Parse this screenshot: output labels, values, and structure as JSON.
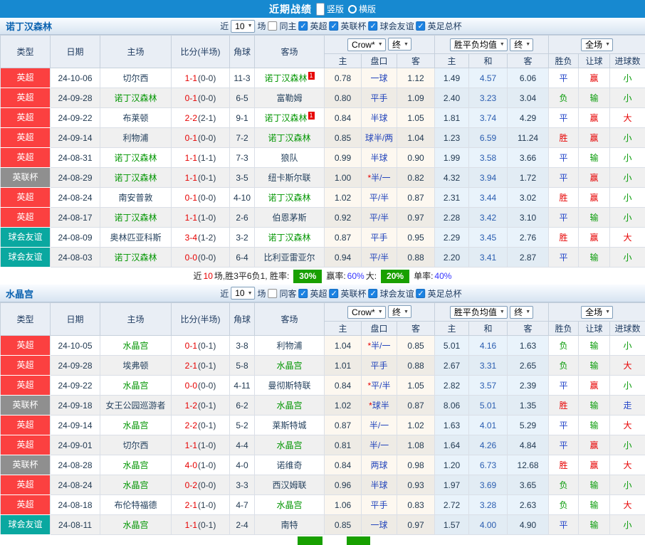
{
  "topbar": {
    "title": "近期战绩",
    "vertical": "竖版",
    "horizontal": "横版"
  },
  "filters": {
    "near": "近",
    "count": "10",
    "unit": "场",
    "leagues": [
      "英超",
      "英联杯",
      "球会友谊",
      "英足总杯"
    ]
  },
  "grid": {
    "col_type": "类型",
    "col_date": "日期",
    "col_home": "主场",
    "col_score": "比分(半场)",
    "col_corner": "角球",
    "col_away": "客场",
    "sel_crow": "Crow*",
    "sel_final": "终",
    "sel_avg": "胜平负均值",
    "sel_scope": "全场",
    "sub_home": "主",
    "sub_handicap": "盘口",
    "sub_away": "客",
    "sub_home2": "主",
    "sub_draw": "和",
    "sub_away2": "客",
    "col_wdl": "胜负",
    "col_let": "让球",
    "col_goals": "进球数"
  },
  "row_fields": [
    "league",
    "date",
    "home",
    "home_sup",
    "score_ft",
    "score_ht",
    "corner",
    "away",
    "away_sup",
    "crow_home",
    "handicap",
    "crow_away",
    "avg_home",
    "avg_draw",
    "avg_away",
    "wdl",
    "let_result",
    "goal_result"
  ],
  "colors": {
    "topbar_blue": "#1789d0",
    "focus_team_green": "#009500",
    "score_red": "#e60000",
    "handicap_blue": "#2244bb",
    "summary_box_green": "#18a000",
    "league_badge": {
      "英超": "#fb4040",
      "英联杯": "#8f8f8f",
      "球会友谊": "#0aa8a0"
    },
    "value_colors": {
      "胜": "#e60000",
      "平": "#2143c8",
      "负": "#089b08",
      "赢": "#e60000",
      "输": "#089b08",
      "大": "#e60000",
      "小": "#089b08",
      "走": "#2143c8"
    }
  },
  "sections": [
    {
      "team": "诺丁汉森林",
      "same_label": "同主",
      "rows": [
        [
          "英超",
          "24-10-06",
          "切尔西",
          "",
          "1-1",
          "(0-0)",
          "11-3",
          "诺丁汉森林",
          "1",
          "0.78",
          "一球",
          "1.12",
          "1.49",
          "4.57",
          "6.06",
          "平",
          "赢",
          "小"
        ],
        [
          "英超",
          "24-09-28",
          "诺丁汉森林",
          "",
          "0-1",
          "(0-0)",
          "6-5",
          "富勒姆",
          "",
          "0.80",
          "平手",
          "1.09",
          "2.40",
          "3.23",
          "3.04",
          "负",
          "输",
          "小"
        ],
        [
          "英超",
          "24-09-22",
          "布莱顿",
          "",
          "2-2",
          "(2-1)",
          "9-1",
          "诺丁汉森林",
          "1",
          "0.84",
          "半球",
          "1.05",
          "1.81",
          "3.74",
          "4.29",
          "平",
          "赢",
          "大"
        ],
        [
          "英超",
          "24-09-14",
          "利物浦",
          "",
          "0-1",
          "(0-0)",
          "7-2",
          "诺丁汉森林",
          "",
          "0.85",
          "球半/两",
          "1.04",
          "1.23",
          "6.59",
          "11.24",
          "胜",
          "赢",
          "小"
        ],
        [
          "英超",
          "24-08-31",
          "诺丁汉森林",
          "",
          "1-1",
          "(1-1)",
          "7-3",
          "狼队",
          "",
          "0.99",
          "半球",
          "0.90",
          "1.99",
          "3.58",
          "3.66",
          "平",
          "输",
          "小"
        ],
        [
          "英联杯",
          "24-08-29",
          "诺丁汉森林",
          "",
          "1-1",
          "(0-1)",
          "3-5",
          "纽卡斯尔联",
          "",
          "1.00",
          "*半/一",
          "0.82",
          "4.32",
          "3.94",
          "1.72",
          "平",
          "赢",
          "小"
        ],
        [
          "英超",
          "24-08-24",
          "南安普敦",
          "",
          "0-1",
          "(0-0)",
          "4-10",
          "诺丁汉森林",
          "",
          "1.02",
          "平/半",
          "0.87",
          "2.31",
          "3.44",
          "3.02",
          "胜",
          "赢",
          "小"
        ],
        [
          "英超",
          "24-08-17",
          "诺丁汉森林",
          "",
          "1-1",
          "(1-0)",
          "2-6",
          "伯恩茅斯",
          "",
          "0.92",
          "平/半",
          "0.97",
          "2.28",
          "3.42",
          "3.10",
          "平",
          "输",
          "小"
        ],
        [
          "球会友谊",
          "24-08-09",
          "奥林匹亚科斯",
          "",
          "3-4",
          "(1-2)",
          "3-2",
          "诺丁汉森林",
          "",
          "0.87",
          "平手",
          "0.95",
          "2.29",
          "3.45",
          "2.76",
          "胜",
          "赢",
          "大"
        ],
        [
          "球会友谊",
          "24-08-03",
          "诺丁汉森林",
          "",
          "0-0",
          "(0-0)",
          "6-4",
          "比利亚雷亚尔",
          "",
          "0.94",
          "平/半",
          "0.88",
          "2.20",
          "3.41",
          "2.87",
          "平",
          "输",
          "小"
        ]
      ],
      "summary_parts": [
        {
          "text": "近",
          "style": "plain"
        },
        {
          "text": "10",
          "style": "red"
        },
        {
          "text": "场,胜3平6负1, 胜率:",
          "style": "plain"
        },
        {
          "text": "30%",
          "style": "box"
        },
        {
          "text": "赢率:",
          "style": "plain"
        },
        {
          "text": "60%",
          "style": "blue"
        },
        {
          "text": "大:",
          "style": "plain"
        },
        {
          "text": "20%",
          "style": "box"
        },
        {
          "text": "单率:",
          "style": "plain"
        },
        {
          "text": "40%",
          "style": "blue"
        }
      ],
      "summary_cutoff": false
    },
    {
      "team": "水晶宫",
      "same_label": "同客",
      "rows": [
        [
          "英超",
          "24-10-05",
          "水晶宫",
          "",
          "0-1",
          "(0-1)",
          "3-8",
          "利物浦",
          "",
          "1.04",
          "*半/一",
          "0.85",
          "5.01",
          "4.16",
          "1.63",
          "负",
          "输",
          "小"
        ],
        [
          "英超",
          "24-09-28",
          "埃弗顿",
          "",
          "2-1",
          "(0-1)",
          "5-8",
          "水晶宫",
          "",
          "1.01",
          "平手",
          "0.88",
          "2.67",
          "3.31",
          "2.65",
          "负",
          "输",
          "大"
        ],
        [
          "英超",
          "24-09-22",
          "水晶宫",
          "",
          "0-0",
          "(0-0)",
          "4-11",
          "曼彻斯特联",
          "",
          "0.84",
          "*平/半",
          "1.05",
          "2.82",
          "3.57",
          "2.39",
          "平",
          "赢",
          "小"
        ],
        [
          "英联杯",
          "24-09-18",
          "女王公园巡游者",
          "",
          "1-2",
          "(0-1)",
          "6-2",
          "水晶宫",
          "",
          "1.02",
          "*球半",
          "0.87",
          "8.06",
          "5.01",
          "1.35",
          "胜",
          "输",
          "走"
        ],
        [
          "英超",
          "24-09-14",
          "水晶宫",
          "",
          "2-2",
          "(0-1)",
          "5-2",
          "莱斯特城",
          "",
          "0.87",
          "半/一",
          "1.02",
          "1.63",
          "4.01",
          "5.29",
          "平",
          "输",
          "大"
        ],
        [
          "英超",
          "24-09-01",
          "切尔西",
          "",
          "1-1",
          "(1-0)",
          "4-4",
          "水晶宫",
          "",
          "0.81",
          "半/一",
          "1.08",
          "1.64",
          "4.26",
          "4.84",
          "平",
          "赢",
          "小"
        ],
        [
          "英联杯",
          "24-08-28",
          "水晶宫",
          "",
          "4-0",
          "(1-0)",
          "4-0",
          "诺维奇",
          "",
          "0.84",
          "两球",
          "0.98",
          "1.20",
          "6.73",
          "12.68",
          "胜",
          "赢",
          "大"
        ],
        [
          "英超",
          "24-08-24",
          "水晶宫",
          "",
          "0-2",
          "(0-0)",
          "3-3",
          "西汉姆联",
          "",
          "0.96",
          "半球",
          "0.93",
          "1.97",
          "3.69",
          "3.65",
          "负",
          "输",
          "小"
        ],
        [
          "英超",
          "24-08-18",
          "布伦特福德",
          "",
          "2-1",
          "(1-0)",
          "4-7",
          "水晶宫",
          "",
          "1.06",
          "平手",
          "0.83",
          "2.72",
          "3.28",
          "2.63",
          "负",
          "输",
          "大"
        ],
        [
          "球会友谊",
          "24-08-11",
          "水晶宫",
          "",
          "1-1",
          "(0-1)",
          "2-4",
          "南特",
          "",
          "0.85",
          "一球",
          "0.97",
          "1.57",
          "4.00",
          "4.90",
          "平",
          "输",
          "小"
        ]
      ],
      "summary_parts": [],
      "summary_cutoff": true
    }
  ]
}
